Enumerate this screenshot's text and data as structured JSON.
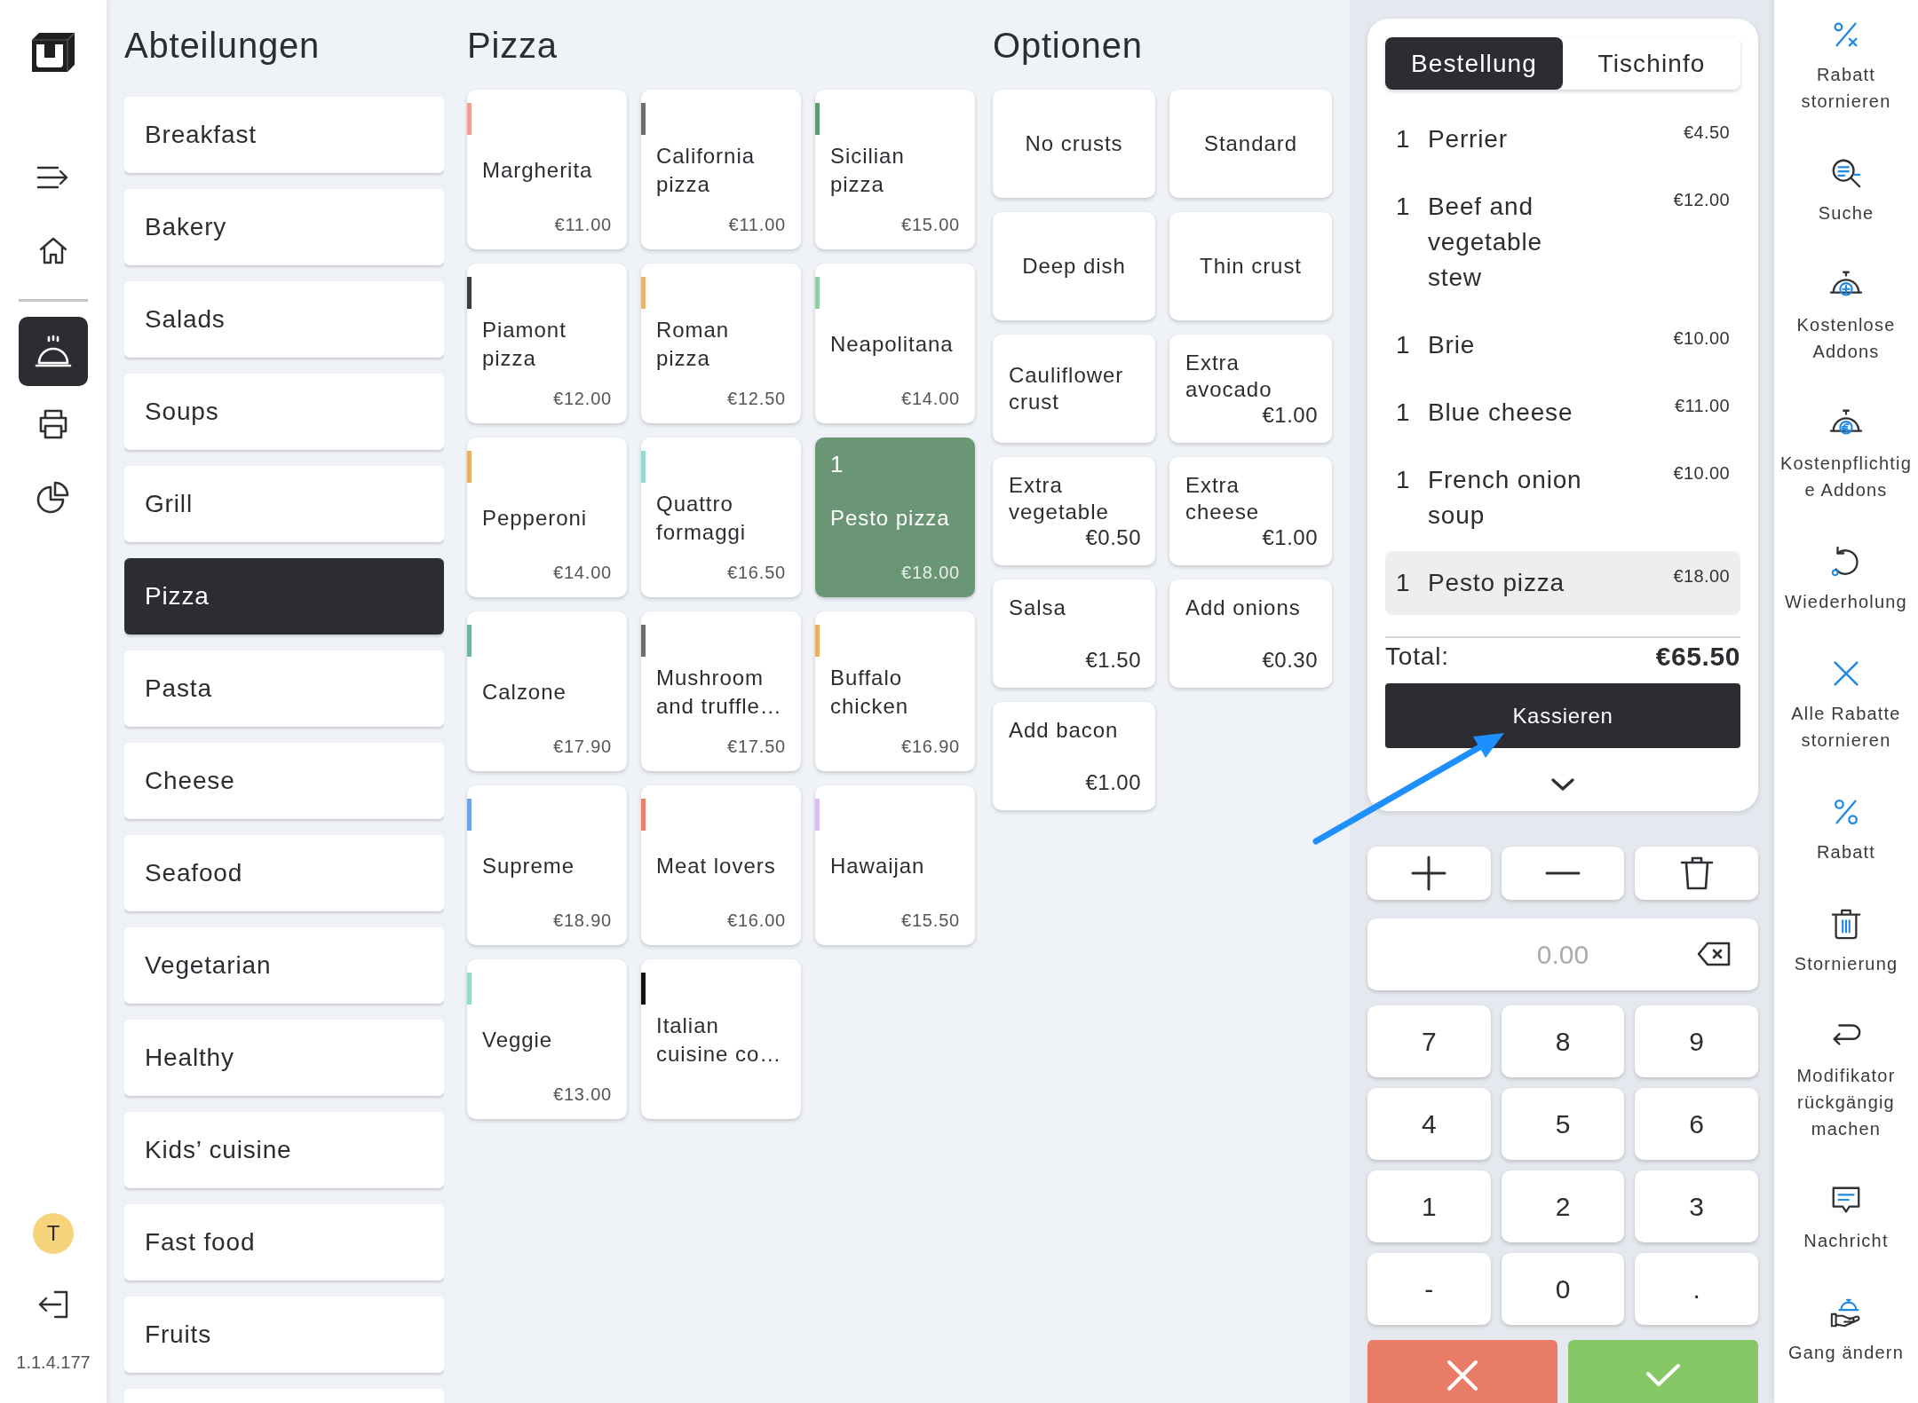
{
  "nav_rail": {
    "groups": [
      {
        "items": [
          {
            "kind": "collapse",
            "selected": false
          },
          {
            "kind": "home",
            "selected": false
          }
        ]
      },
      {
        "items": [
          {
            "kind": "orders",
            "selected": true
          },
          {
            "kind": "print",
            "selected": false
          },
          {
            "kind": "reports",
            "selected": false
          }
        ]
      }
    ],
    "user_initial": "T",
    "version": "1.1.4.177"
  },
  "departments": {
    "title": "Abteilungen",
    "items": [
      {
        "label": "Breakfast",
        "selected": false
      },
      {
        "label": "Bakery",
        "selected": false
      },
      {
        "label": "Salads",
        "selected": false
      },
      {
        "label": "Soups",
        "selected": false
      },
      {
        "label": "Grill",
        "selected": false
      },
      {
        "label": "Pizza",
        "selected": true
      },
      {
        "label": "Pasta",
        "selected": false
      },
      {
        "label": "Cheese",
        "selected": false
      },
      {
        "label": "Seafood",
        "selected": false
      },
      {
        "label": "Vegetarian",
        "selected": false
      },
      {
        "label": "Healthy",
        "selected": false
      },
      {
        "label": "Kids’ cuisine",
        "selected": false
      },
      {
        "label": "Fast food",
        "selected": false
      },
      {
        "label": "Fruits",
        "selected": false
      }
    ]
  },
  "products": {
    "title": "Pizza",
    "items": [
      {
        "name": "Margherita",
        "price": "€11.00",
        "color": "#f2a094",
        "selected": false
      },
      {
        "name": "California pizza",
        "price": "€11.00",
        "color": "#6e6e6e",
        "selected": false
      },
      {
        "name": "Sicilian pizza",
        "price": "€15.00",
        "color": "#5e9b6e",
        "selected": false
      },
      {
        "name": "Piamont pizza",
        "price": "€12.00",
        "color": "#3c3c3c",
        "selected": false
      },
      {
        "name": "Roman pizza",
        "price": "€12.50",
        "color": "#e9b36f",
        "selected": false
      },
      {
        "name": "Neapolitana",
        "price": "€14.00",
        "color": "#8fcfa2",
        "selected": false
      },
      {
        "name": "Pepperoni",
        "price": "€14.00",
        "color": "#e9b062",
        "selected": false
      },
      {
        "name": "Quattro formaggi",
        "price": "€16.50",
        "color": "#93dccf",
        "selected": false
      },
      {
        "name": "Pesto pizza",
        "price": "€18.00",
        "count": "1",
        "selected": true
      },
      {
        "name": "Calzone",
        "price": "€17.90",
        "color": "#70b4a0",
        "selected": false
      },
      {
        "name": "Mushroom and truffle…",
        "price": "€17.50",
        "color": "#6e6e6e",
        "selected": false
      },
      {
        "name": "Buffalo chicken",
        "price": "€16.90",
        "color": "#e9b062",
        "selected": false
      },
      {
        "name": "Supreme",
        "price": "€18.90",
        "color": "#72a3e2",
        "selected": false
      },
      {
        "name": "Meat lovers",
        "price": "€16.00",
        "color": "#ea7d6c",
        "selected": false
      },
      {
        "name": "Hawaijan",
        "price": "€15.50",
        "color": "#d9bdf5",
        "selected": false
      },
      {
        "name": "Veggie",
        "price": "€13.00",
        "color": "#93dccc",
        "selected": false
      },
      {
        "name": "Italian cuisine co…",
        "color": "#111111",
        "selected": false
      }
    ]
  },
  "options": {
    "title": "Optionen",
    "items": [
      {
        "name": "No crusts"
      },
      {
        "name": "Standard"
      },
      {
        "name": "Deep dish"
      },
      {
        "name": "Thin crust"
      },
      {
        "name": "Cauliflower crust"
      },
      {
        "name": "Extra avocado",
        "price": "€1.00"
      },
      {
        "name": "Extra vegetable",
        "price": "€0.50"
      },
      {
        "name": "Extra cheese",
        "price": "€1.00"
      },
      {
        "name": "Salsa",
        "price": "€1.50"
      },
      {
        "name": "Add onions",
        "price": "€0.30"
      },
      {
        "name": "Add bacon",
        "price": "€1.00"
      }
    ]
  },
  "order": {
    "tabs": [
      {
        "label": "Bestellung",
        "selected": true
      },
      {
        "label": "Tischinfo",
        "selected": false
      }
    ],
    "lines": [
      {
        "qty": "1",
        "name": "Perrier",
        "price": "€4.50",
        "selected": false
      },
      {
        "qty": "1",
        "name": "Beef and vegetable stew",
        "price": "€12.00",
        "selected": false
      },
      {
        "qty": "1",
        "name": "Brie",
        "price": "€10.00",
        "selected": false
      },
      {
        "qty": "1",
        "name": "Blue cheese",
        "price": "€11.00",
        "selected": false
      },
      {
        "qty": "1",
        "name": "French onion soup",
        "price": "€10.00",
        "selected": false
      },
      {
        "qty": "1",
        "name": "Pesto pizza",
        "price": "€18.00",
        "selected": true
      }
    ],
    "total_label": "Total:",
    "total": "€65.50",
    "checkout_label": "Kassieren"
  },
  "keypad": {
    "placeholder": "0.00",
    "keys": [
      "7",
      "8",
      "9",
      "4",
      "5",
      "6",
      "1",
      "2",
      "3",
      "-",
      "0",
      "."
    ]
  },
  "actions": {
    "items": [
      {
        "kind": "discount_cancel",
        "label": "Rabatt stornieren"
      },
      {
        "kind": "search",
        "label": "Suche"
      },
      {
        "kind": "free_addons",
        "label": "Kostenlose Addons"
      },
      {
        "kind": "paid_addons",
        "label": "Kostenpflichtige Addons"
      },
      {
        "kind": "repeat",
        "label": "Wiederholung"
      },
      {
        "kind": "cancel_discounts",
        "label": "Alle Rabatte stornieren"
      },
      {
        "kind": "discount",
        "label": "Rabatt"
      },
      {
        "kind": "void",
        "label": "Stornierung"
      },
      {
        "kind": "undo_modifier",
        "label": "Modifikator rückgängig machen"
      },
      {
        "kind": "message",
        "label": "Nachricht"
      },
      {
        "kind": "change_course",
        "label": "Gang ändern"
      }
    ]
  }
}
